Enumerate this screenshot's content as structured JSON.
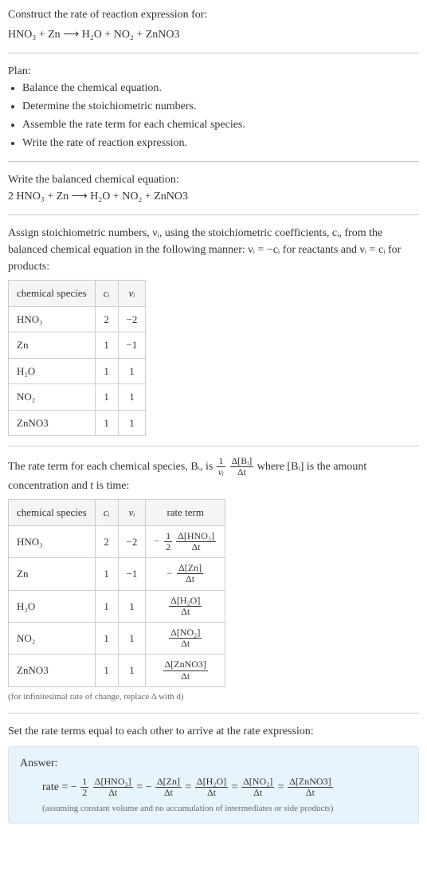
{
  "intro": {
    "line1": "Construct the rate of reaction expression for:",
    "equation": "HNO₃ + Zn ⟶ H₂O + NO₂ + ZnNO3"
  },
  "plan": {
    "heading": "Plan:",
    "items": [
      "Balance the chemical equation.",
      "Determine the stoichiometric numbers.",
      "Assemble the rate term for each chemical species.",
      "Write the rate of reaction expression."
    ]
  },
  "balanced": {
    "heading": "Write the balanced chemical equation:",
    "equation": "2 HNO₃ + Zn ⟶ H₂O + NO₂ + ZnNO3"
  },
  "stoich_text": "Assign stoichiometric numbers, νᵢ, using the stoichiometric coefficients, cᵢ, from the balanced chemical equation in the following manner: νᵢ = −cᵢ for reactants and νᵢ = cᵢ for products:",
  "table1": {
    "headers": [
      "chemical species",
      "cᵢ",
      "νᵢ"
    ],
    "rows": [
      {
        "species": "HNO₃",
        "c": "2",
        "nu": "−2"
      },
      {
        "species": "Zn",
        "c": "1",
        "nu": "−1"
      },
      {
        "species": "H₂O",
        "c": "1",
        "nu": "1"
      },
      {
        "species": "NO₂",
        "c": "1",
        "nu": "1"
      },
      {
        "species": "ZnNO3",
        "c": "1",
        "nu": "1"
      }
    ]
  },
  "rate_text_pre": "The rate term for each chemical species, Bᵢ, is ",
  "rate_text_post": " where [Bᵢ] is the amount concentration and t is time:",
  "rate_frac1_num": "1",
  "rate_frac1_den": "νᵢ",
  "rate_frac2_num": "Δ[Bᵢ]",
  "rate_frac2_den": "Δt",
  "table2": {
    "headers": [
      "chemical species",
      "cᵢ",
      "νᵢ",
      "rate term"
    ],
    "rows": [
      {
        "species": "HNO₃",
        "c": "2",
        "nu": "−2",
        "neg": "−",
        "coef_num": "1",
        "coef_den": "2",
        "conc_num": "Δ[HNO₃]",
        "conc_den": "Δt"
      },
      {
        "species": "Zn",
        "c": "1",
        "nu": "−1",
        "neg": "−",
        "coef_num": "",
        "coef_den": "",
        "conc_num": "Δ[Zn]",
        "conc_den": "Δt"
      },
      {
        "species": "H₂O",
        "c": "1",
        "nu": "1",
        "neg": "",
        "coef_num": "",
        "coef_den": "",
        "conc_num": "Δ[H₂O]",
        "conc_den": "Δt"
      },
      {
        "species": "NO₂",
        "c": "1",
        "nu": "1",
        "neg": "",
        "coef_num": "",
        "coef_den": "",
        "conc_num": "Δ[NO₂]",
        "conc_den": "Δt"
      },
      {
        "species": "ZnNO3",
        "c": "1",
        "nu": "1",
        "neg": "",
        "coef_num": "",
        "coef_den": "",
        "conc_num": "Δ[ZnNO3]",
        "conc_den": "Δt"
      }
    ]
  },
  "note1": "(for infinitesimal rate of change, replace Δ with d)",
  "final_heading": "Set the rate terms equal to each other to arrive at the rate expression:",
  "answer": {
    "label": "Answer:",
    "prefix": "rate = −",
    "terms": [
      {
        "coef_num": "1",
        "coef_den": "2",
        "conc_num": "Δ[HNO₃]",
        "conc_den": "Δt",
        "sep": " = −"
      },
      {
        "coef_num": "",
        "coef_den": "",
        "conc_num": "Δ[Zn]",
        "conc_den": "Δt",
        "sep": " = "
      },
      {
        "coef_num": "",
        "coef_den": "",
        "conc_num": "Δ[H₂O]",
        "conc_den": "Δt",
        "sep": " = "
      },
      {
        "coef_num": "",
        "coef_den": "",
        "conc_num": "Δ[NO₂]",
        "conc_den": "Δt",
        "sep": " = "
      },
      {
        "coef_num": "",
        "coef_den": "",
        "conc_num": "Δ[ZnNO3]",
        "conc_den": "Δt",
        "sep": ""
      }
    ],
    "note": "(assuming constant volume and no accumulation of intermediates or side products)"
  }
}
